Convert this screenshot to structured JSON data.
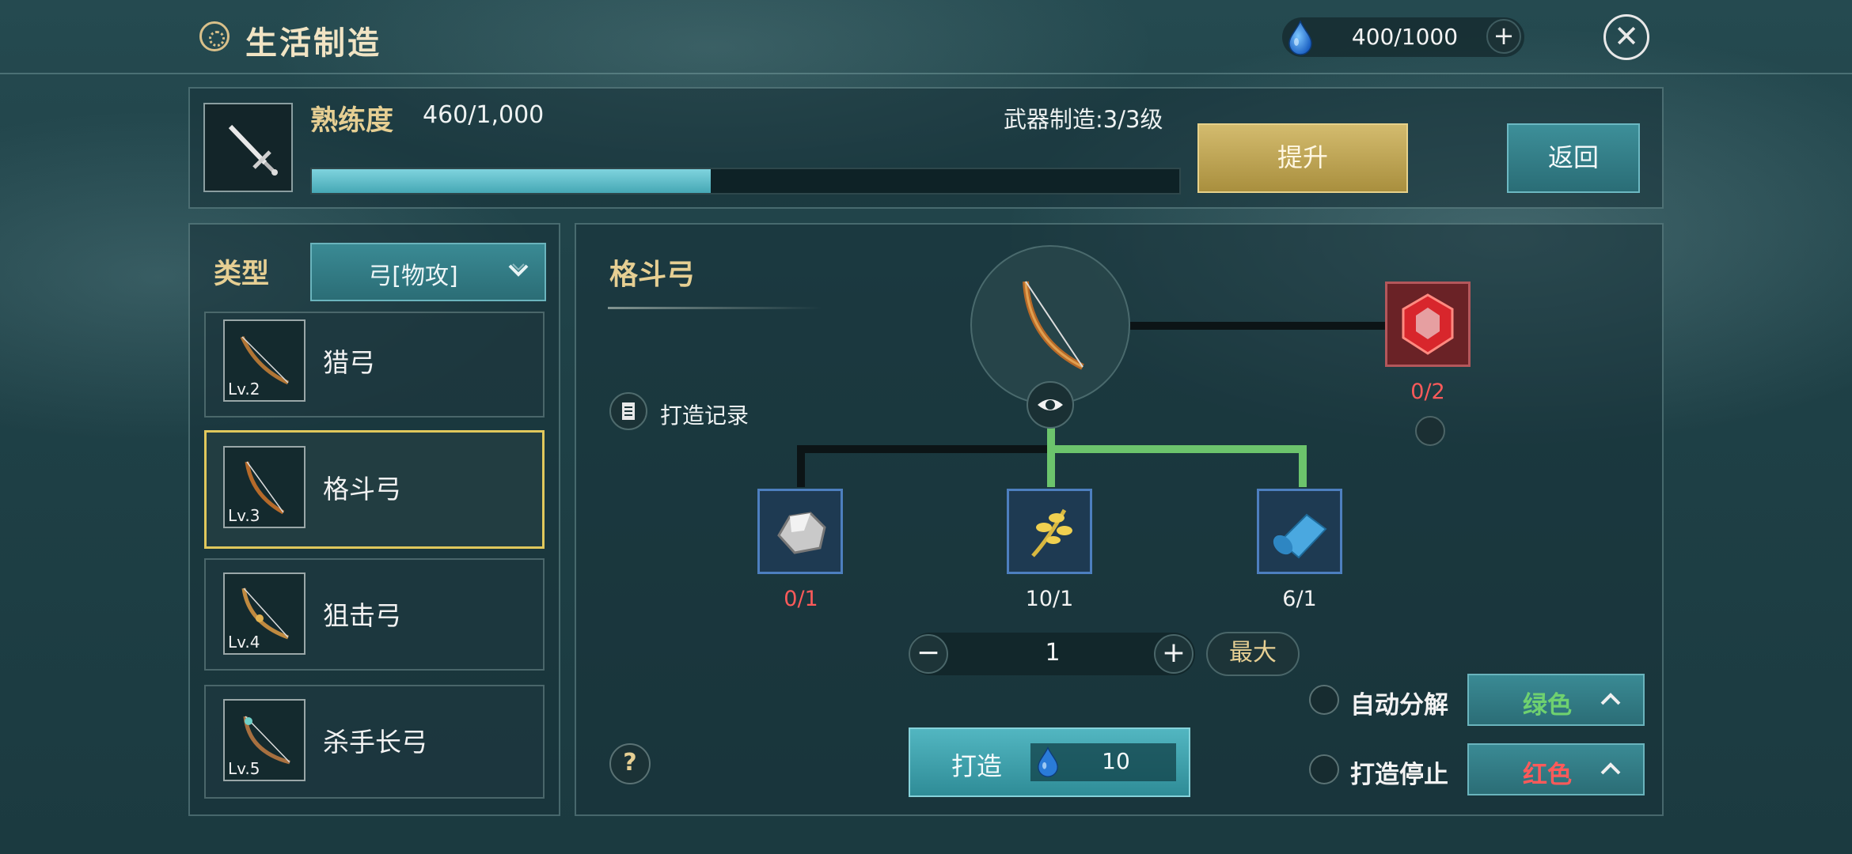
{
  "header": {
    "title": "生活制造",
    "resource": "400/1000",
    "plus_icon": "+",
    "close_icon": "✕"
  },
  "proficiency": {
    "label": "熟练度",
    "value": "460/1,000",
    "progress": 0.46,
    "level_text": "武器制造:3/3级",
    "upgrade_label": "提升",
    "back_label": "返回"
  },
  "category": {
    "label": "类型",
    "selected": "弓[物攻]"
  },
  "items": [
    {
      "name": "猎弓",
      "level": "Lv.2",
      "selected": false
    },
    {
      "name": "格斗弓",
      "level": "Lv.3",
      "selected": true
    },
    {
      "name": "狙击弓",
      "level": "Lv.4",
      "selected": false
    },
    {
      "name": "杀手长弓",
      "level": "Lv.5",
      "selected": false
    }
  ],
  "detail": {
    "title": "格斗弓",
    "record_label": "打造记录",
    "materials": [
      {
        "icon": "ore-icon",
        "count": "0/1",
        "color": "#ff5a5a"
      },
      {
        "icon": "herb-icon",
        "count": "10/1",
        "color": "#f2f2f2"
      },
      {
        "icon": "cloth-roll-icon",
        "count": "6/1",
        "color": "#f2f2f2"
      }
    ],
    "gem": {
      "icon": "red-gem-icon",
      "count": "0/2",
      "color": "#ff5a5a"
    },
    "quantity": "1",
    "max_label": "最大",
    "minus": "−",
    "plus": "+",
    "help": "?",
    "auto_decompose_label": "自动分解",
    "auto_decompose_value": "绿色",
    "auto_decompose_color": "#6fd16f",
    "stop_label": "打造停止",
    "stop_value": "红色",
    "stop_color": "#ff5a5a",
    "craft_label": "打造",
    "craft_cost": "10"
  },
  "colors": {
    "gold": "#e6cf93",
    "teal": "#2f8c97",
    "green_line": "#6cc46c"
  }
}
